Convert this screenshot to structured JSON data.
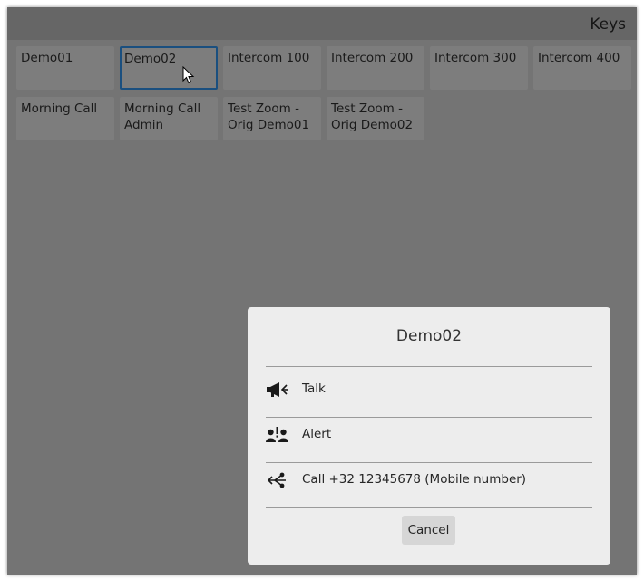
{
  "header": {
    "title": "Keys"
  },
  "keys": {
    "row1": [
      "Demo01",
      "Demo02",
      "Intercom 100",
      "Intercom 200",
      "Intercom 300",
      "Intercom 400"
    ],
    "row2": [
      "Morning Call",
      "Morning Call Admin",
      "Test Zoom - Orig Demo01",
      "Test Zoom - Orig Demo02"
    ],
    "selected": "Demo02"
  },
  "dialog": {
    "title": "Demo02",
    "actions": [
      {
        "label": "Talk",
        "icon": "megaphone-icon"
      },
      {
        "label": "Alert",
        "icon": "alert-users-icon"
      },
      {
        "label": "Call +32 12345678 (Mobile number)",
        "icon": "call-forward-icon"
      }
    ],
    "cancel_label": "Cancel"
  },
  "colors": {
    "background": "#747474",
    "header": "#666666",
    "key": "#7d7d7d",
    "selected_border": "#1a4f7f",
    "dialog": "#ededed",
    "button": "#d6d6d6"
  }
}
